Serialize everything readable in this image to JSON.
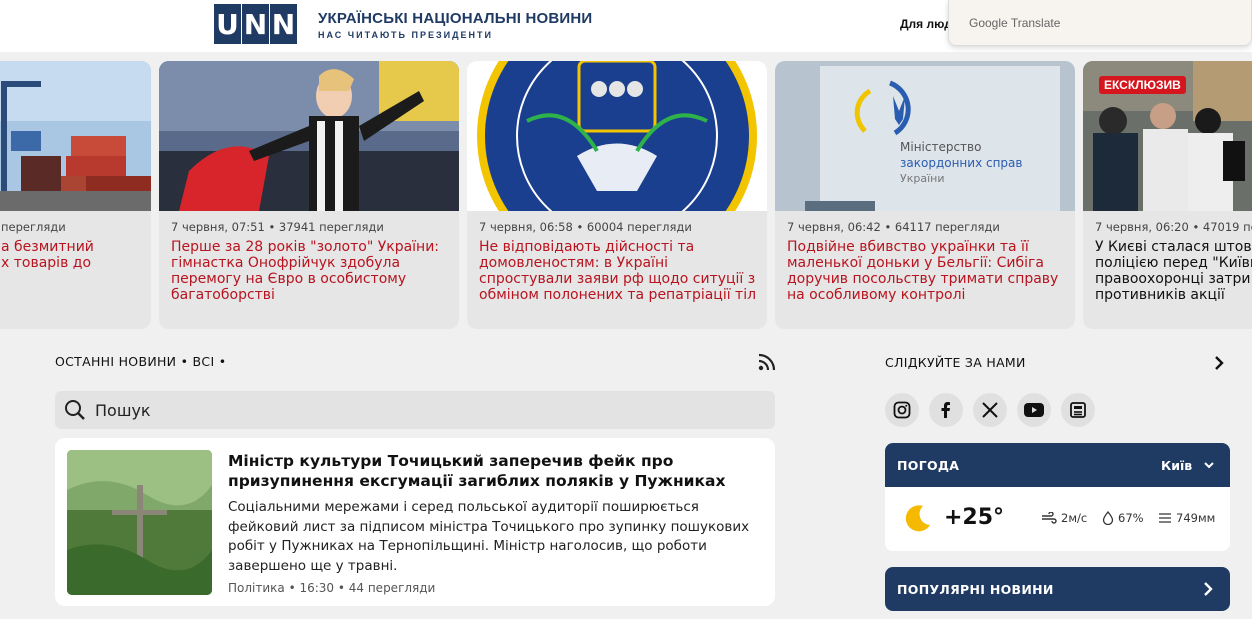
{
  "header": {
    "logo_letters": [
      "U",
      "N",
      "N"
    ],
    "brand_title": "УКРАЇНСЬКІ НАЦІОНАЛЬНІ НОВИНИ",
    "brand_subtitle": "НАС ЧИТАЮТЬ ПРЕЗИДЕНТИ",
    "link_partial": "Для люд",
    "google_translate_label": "Google Translate",
    "brand_color": "#1f3a63"
  },
  "carousel": [
    {
      "meta": "перегляди",
      "title": "а безмитний\nх товарів до",
      "image": "shipping-containers-photo"
    },
    {
      "meta": "7 червня, 07:51 • 37941 перегляди",
      "title": "Перше за 28 років \"золото\" України: гімнастка Онофрійчук здобула перемогу на Євро в особистому багатоборстві",
      "image": "gymnast-photo"
    },
    {
      "meta": "7 червня, 06:58 • 60004 перегляди",
      "title": "Не відповідають дійсності та домовленостям: в Україні спростували заяви рф щодо ситуції з обміном полонених та репатріації тіл",
      "image": "coordination-headquarters-emblem"
    },
    {
      "meta": "7 червня, 06:42 • 64117 перегляди",
      "title": "Подвійне вбивство українки та її маленької доньки у Бельгії: Сибіга доручив посольству тримати справу на особливому контролі",
      "image": "ministry-foreign-affairs-sign",
      "sign_line1": "Міністерство",
      "sign_line2": "закордонних справ",
      "sign_line3": "України"
    },
    {
      "meta": "7 червня, 06:20 • 47019 пе",
      "title": "У Києві сталася штовх поліцією перед \"Київп правоохоронці затри противників акції",
      "badge": "ЕКСКЛЮЗИВ",
      "image": "crowd-police-photo"
    }
  ],
  "latest": {
    "section_title": "ОСТАННІ НОВИНИ • ВСІ •",
    "search_placeholder": "Пошук",
    "item": {
      "title": "Міністр культури Точицький заперечив фейк про призупинення ексгумації загиблих поляків у Пужниках",
      "lead": "Соціальними мережами і серед польської аудиторії поширюється фейковий лист за підписом міністра Точицького про зупинку пошукових робіт у Пужниках на Тернопільщині. Міністр наголосив, що роботи завершено ще у травні.",
      "meta": "Політика • 16:30 • 44 перегляди",
      "image": "wooden-cross-in-grass-photo"
    }
  },
  "sidebar": {
    "follow_title": "СЛІДКУЙТЕ ЗА НАМИ",
    "socials": [
      "instagram-icon",
      "facebook-icon",
      "x-icon",
      "youtube-icon",
      "news-icon"
    ],
    "weather": {
      "title": "ПОГОДА",
      "city": "Київ",
      "temperature": "+25°",
      "wind": "2м/с",
      "humidity": "67%",
      "pressure": "749мм"
    },
    "popular_title": "ПОПУЛЯРНІ НОВИНИ"
  },
  "colors": {
    "headline_red": "#b8141f",
    "navy": "#1f3a63",
    "badge_red": "#d5161e"
  }
}
